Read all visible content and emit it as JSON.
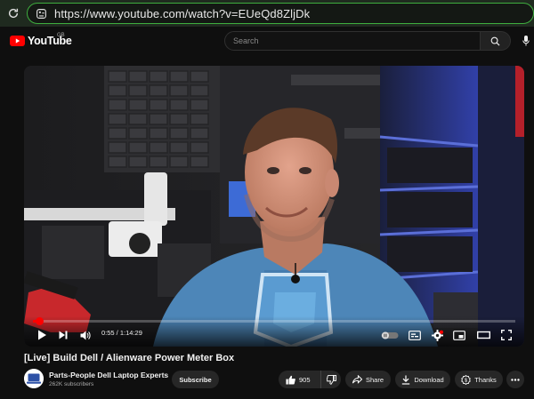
{
  "browser": {
    "url": "https://www.youtube.com/watch?v=EUeQd8ZljDk",
    "reload_icon": "reload-icon",
    "site_info_icon": "site-settings-icon"
  },
  "header": {
    "logo_text": "YouTube",
    "country_code": "GB",
    "search_placeholder": "Search",
    "search_icon": "search-icon",
    "mic_icon": "microphone-icon"
  },
  "player": {
    "current_time": "0:55",
    "duration": "1:14:29",
    "time_display": "0:55 / 1:14:29",
    "progress_fraction": 0.0123,
    "buttons": [
      "play-icon",
      "next-icon",
      "volume-icon",
      "autoplay-toggle",
      "subtitles-icon",
      "settings-icon",
      "miniplayer-icon",
      "theater-icon",
      "fullscreen-icon"
    ],
    "progress_color": "#ff0000"
  },
  "video": {
    "title": "[Live] Build Dell / Alienware Power Meter Box",
    "channel_name": "Parts-People Dell Laptop Experts",
    "subscribers": "262K subscribers",
    "subscribe_label": "Subscribe",
    "like_count": "905",
    "share_label": "Share",
    "download_label": "Download",
    "thanks_label": "Thanks"
  },
  "colors": {
    "brand_red": "#ff0000",
    "browser_accent": "#3fae3f",
    "background": "#0f0f0f",
    "pill_bg": "#272727"
  }
}
